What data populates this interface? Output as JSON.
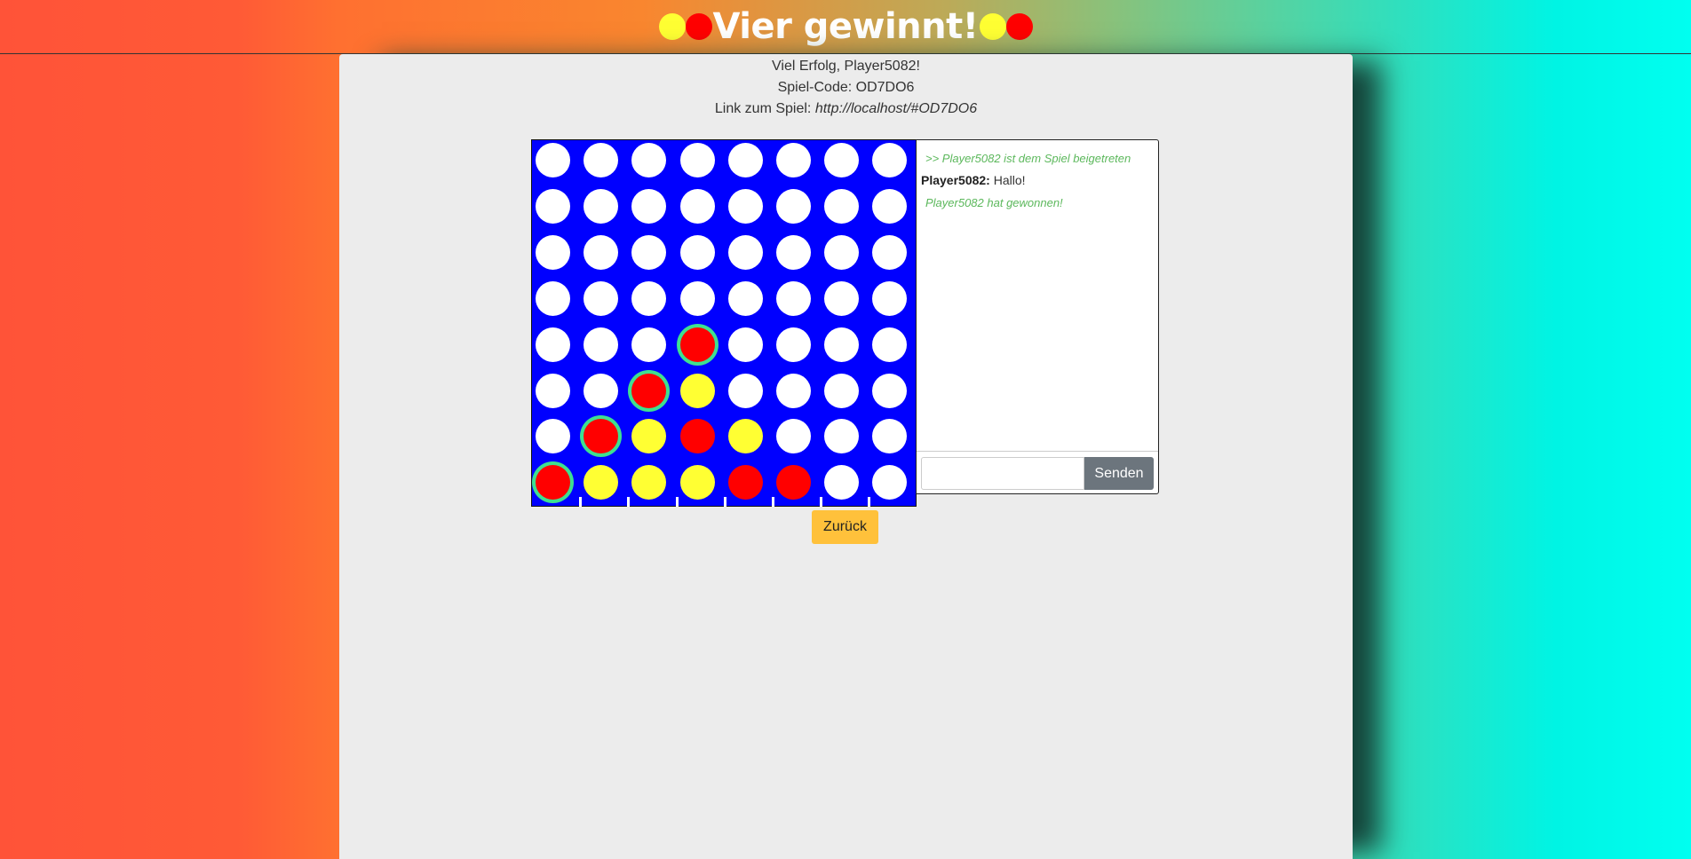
{
  "header": {
    "title": "Vier gewinnt!",
    "dots": [
      "yellow",
      "red"
    ]
  },
  "info": {
    "welcome": "Viel Erfolg, Player5082!",
    "code_label": "Spiel-Code: OD7DO6",
    "link_prefix": "Link zum Spiel: ",
    "link_url": "http://localhost/#OD7DO6"
  },
  "colors": {
    "board": "#0000ff",
    "empty": "#ffffff",
    "red": "#ff0000",
    "yellow": "#ffff33",
    "win_ring": "#3ee090"
  },
  "board": {
    "rows": [
      [
        "w",
        "w",
        "w",
        "w",
        "w",
        "w",
        "w",
        "w"
      ],
      [
        "w",
        "w",
        "w",
        "w",
        "w",
        "w",
        "w",
        "w"
      ],
      [
        "w",
        "w",
        "w",
        "w",
        "w",
        "w",
        "w",
        "w"
      ],
      [
        "w",
        "w",
        "w",
        "w",
        "w",
        "w",
        "w",
        "w"
      ],
      [
        "w",
        "w",
        "w",
        "r",
        "w",
        "w",
        "w",
        "w"
      ],
      [
        "w",
        "w",
        "r",
        "y",
        "w",
        "w",
        "w",
        "w"
      ],
      [
        "w",
        "r",
        "y",
        "r",
        "y",
        "w",
        "w",
        "w"
      ],
      [
        "r",
        "y",
        "y",
        "y",
        "r",
        "r",
        "w",
        "w"
      ]
    ],
    "winning_cells": [
      [
        4,
        3
      ],
      [
        5,
        2
      ],
      [
        6,
        1
      ],
      [
        7,
        0
      ]
    ]
  },
  "chat": {
    "messages": [
      {
        "type": "system",
        "text": ">> Player5082 ist dem Spiel beigetreten"
      },
      {
        "type": "user",
        "user": "Player5082:",
        "text": "Hallo!"
      },
      {
        "type": "system",
        "text": "Player5082 hat gewonnen!"
      }
    ],
    "input_value": "",
    "send_label": "Senden"
  },
  "back_label": "Zurück"
}
